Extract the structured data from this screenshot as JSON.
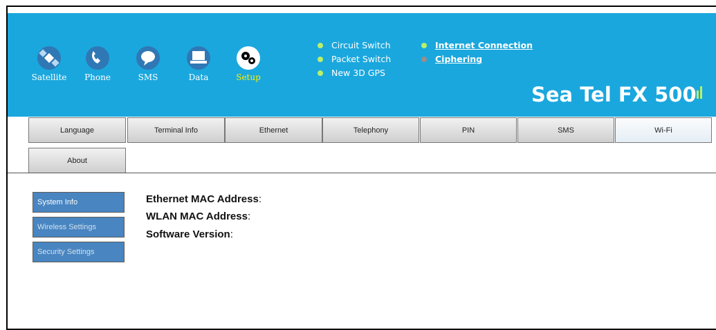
{
  "nav": {
    "items": [
      {
        "label": "Satellite",
        "icon": "satellite-icon"
      },
      {
        "label": "Phone",
        "icon": "phone-icon"
      },
      {
        "label": "SMS",
        "icon": "sms-icon"
      },
      {
        "label": "Data",
        "icon": "data-icon"
      },
      {
        "label": "Setup",
        "icon": "gears-icon",
        "active": true
      }
    ]
  },
  "status": {
    "left": [
      "Circuit Switch",
      "Packet Switch",
      "New 3D GPS"
    ],
    "right": [
      "Internet Connection",
      "Ciphering"
    ]
  },
  "brand": "Sea Tel FX 500",
  "tabs": [
    "Language",
    "Terminal Info",
    "Ethernet",
    "Telephony",
    "PIN",
    "SMS",
    "Wi-Fi",
    "About"
  ],
  "sidebar": [
    "System Info",
    "Wireless Settings",
    "Security Settings"
  ],
  "info": {
    "ethernet_mac": "Ethernet MAC Address",
    "wlan_mac": "WLAN MAC Address",
    "software": "Software Version"
  },
  "colors": {
    "header": "#1aa7dd",
    "accent": "#ffee00",
    "sidebar": "#3f7fbe"
  }
}
